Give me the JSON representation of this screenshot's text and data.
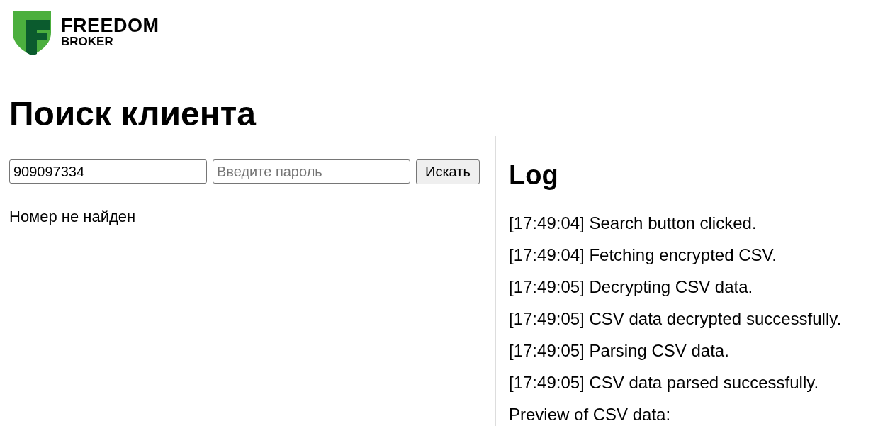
{
  "logo": {
    "line_1": "FREEDOM",
    "line_2": "BROKER"
  },
  "title": "Поиск клиента",
  "search": {
    "phone_value": "909097334",
    "password_placeholder": "Введите пароль",
    "button": "Искать"
  },
  "result_message": "Номер не найден",
  "log": {
    "title": "Log",
    "entries": [
      {
        "time": "[17:49:04]",
        "message": "Search button clicked."
      },
      {
        "time": "[17:49:04]",
        "message": "Fetching encrypted CSV."
      },
      {
        "time": "[17:49:05]",
        "message": "Decrypting CSV data."
      },
      {
        "time": "[17:49:05]",
        "message": "CSV data decrypted successfully."
      },
      {
        "time": "[17:49:05]",
        "message": "Parsing CSV data."
      },
      {
        "time": "[17:49:05]",
        "message": "CSV data parsed successfully."
      }
    ],
    "preview_label": "Preview of CSV data:"
  }
}
